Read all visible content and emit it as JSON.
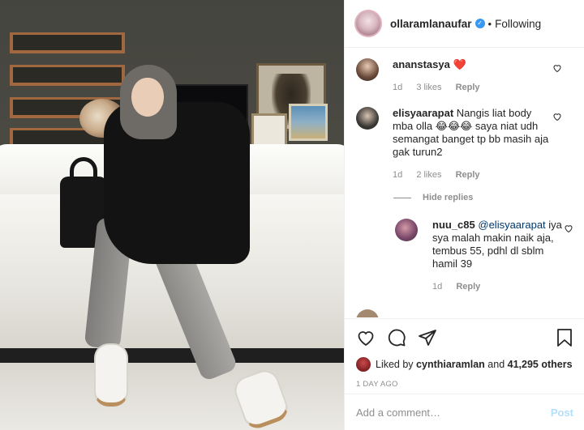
{
  "post": {
    "username": "ollaramlanaufar",
    "verified": true,
    "separator": "•",
    "follow_state": "Following"
  },
  "comments": [
    {
      "username": "ananstasya",
      "text": "",
      "emoji": "❤️",
      "time": "1d",
      "likes": "3 likes",
      "reply": "Reply"
    },
    {
      "username": "elisyaarapat",
      "text": "Nangis liat body mba olla 😂😂😂 saya niat udh semangat banget tp bb masih aja gak turun2",
      "time": "1d",
      "likes": "2 likes",
      "reply": "Reply"
    }
  ],
  "hide_replies": "Hide replies",
  "reply": {
    "username": "nuu_c85",
    "mention": "@elisyaarapat",
    "text": "iya sya malah makin naik aja, tembus 55, pdhl dl sblm hamil 39",
    "time": "1d",
    "reply": "Reply"
  },
  "icons": {
    "like": "heart-icon",
    "comment": "comment-icon",
    "share": "share-icon",
    "save": "bookmark-icon",
    "verified": "verified-badge-icon"
  },
  "likes": {
    "prefix": "Liked by",
    "user": "cynthiaramlan",
    "middle": "and",
    "count": "41,295 others"
  },
  "timestamp": "1 DAY AGO",
  "composer": {
    "placeholder": "Add a comment…",
    "post_label": "Post"
  },
  "colors": {
    "verified": "#3897f0",
    "post_disabled": "#b2dffc",
    "heart_red": "#ed4956",
    "muted": "#8e8e8e"
  }
}
